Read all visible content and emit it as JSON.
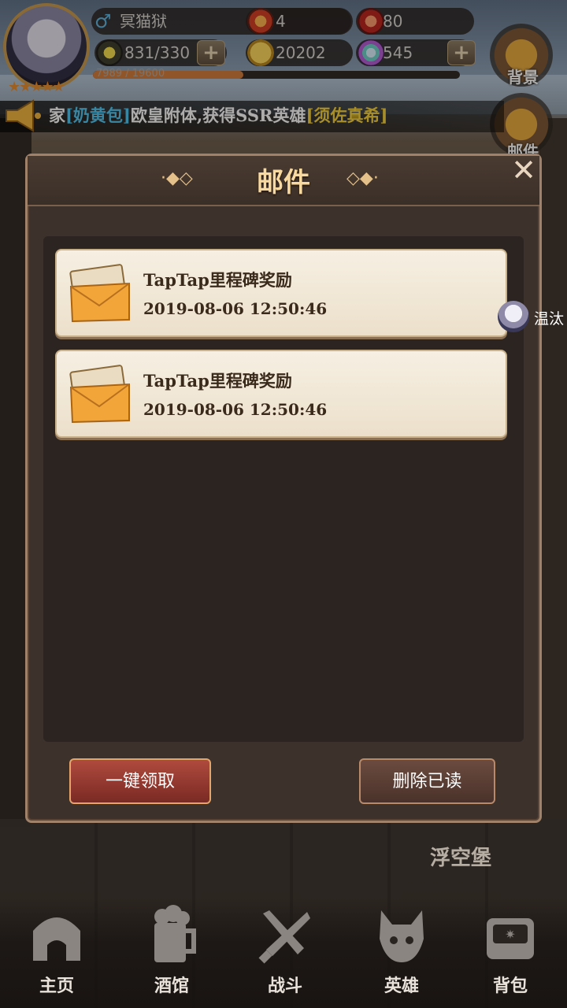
{
  "player": {
    "name": "冥猫狱",
    "gender_icon": "male-icon",
    "level_stars": "★★★★★"
  },
  "resources": {
    "power": "4",
    "gems_red": "80",
    "stamina": "831/330",
    "gold": "20202",
    "crystals": "545"
  },
  "xp": {
    "text": "7989 / 19600",
    "fraction": 0.41
  },
  "side": {
    "backpack_label": "背景",
    "mail_label": "邮件"
  },
  "notice": {
    "prefix": "家",
    "player": "[奶黄包]",
    "middle": "欧皇附体,获得SSR英雄",
    "hero": "[须佐真希]"
  },
  "modal": {
    "title": "邮件",
    "close_icon": "close-icon",
    "mails": [
      {
        "title": "TapTap里程碑奖励",
        "date": "2019-08-06 12:50:46",
        "icon": "envelope-icon"
      },
      {
        "title": "TapTap里程碑奖励",
        "date": "2019-08-06 12:50:46",
        "icon": "envelope-icon"
      }
    ],
    "claim_all": "一键领取",
    "delete_read": "删除已读"
  },
  "friend": {
    "name": "温汰"
  },
  "floating_castle": "浮空堡",
  "nav": [
    {
      "label": "主页",
      "icon": "home-icon"
    },
    {
      "label": "酒馆",
      "icon": "beer-icon"
    },
    {
      "label": "战斗",
      "icon": "swords-icon"
    },
    {
      "label": "英雄",
      "icon": "hero-icon"
    },
    {
      "label": "背包",
      "icon": "bag-icon"
    }
  ],
  "colors": {
    "accent": "#f8d9a0",
    "notice_name": "#4cc5f0",
    "notice_hero": "#f6d23a",
    "claim": "#b04a3e"
  }
}
